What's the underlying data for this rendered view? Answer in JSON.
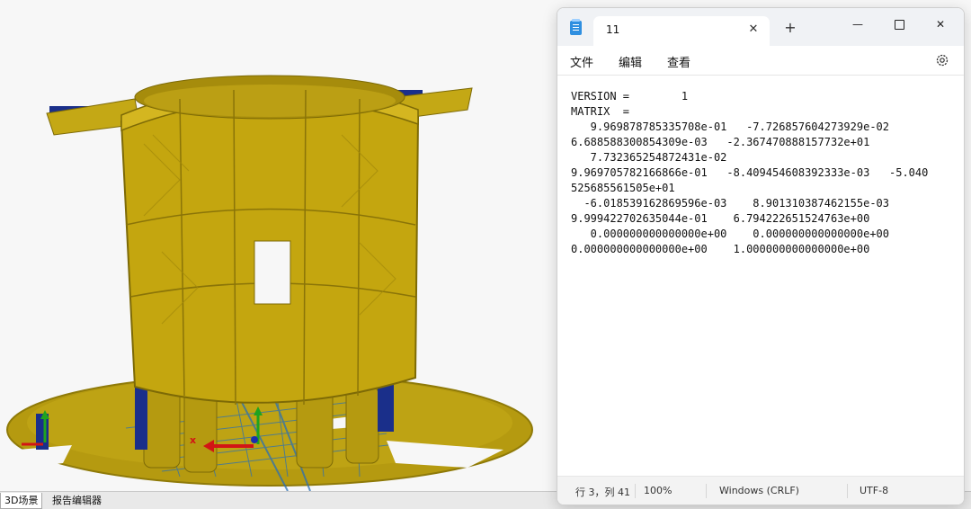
{
  "viewport": {
    "axis_label": "x"
  },
  "bottom_tabs": [
    {
      "label": "3D场景"
    },
    {
      "label": "报告编辑器"
    }
  ],
  "notepad": {
    "tab_title": "11",
    "tab_close": "✕",
    "new_tab": "+",
    "menu": [
      "文件",
      "编辑",
      "查看"
    ],
    "icons": {
      "app": "notepad-icon",
      "settings": "gear-icon"
    },
    "window_controls": {
      "minimize": "—",
      "close": "✕"
    },
    "content": "VERSION =        1\nMATRIX  =\n   9.969878785335708e-01   -7.726857604273929e-02\n6.688588300854309e-03   -2.367470888157732e+01\n   7.732365254872431e-02\n9.969705782166866e-01   -8.409454608392333e-03   -5.040\n525685561505e+01\n  -6.018539162869596e-03    8.901310387462155e-03\n9.999422702635044e-01    6.794222651524763e+00\n   0.000000000000000e+00    0.000000000000000e+00\n0.000000000000000e+00    1.000000000000000e+00",
    "status": {
      "position": "行 3，列 41",
      "zoom": "100%",
      "line_ending": "Windows (CRLF)",
      "encoding": "UTF-8"
    }
  }
}
